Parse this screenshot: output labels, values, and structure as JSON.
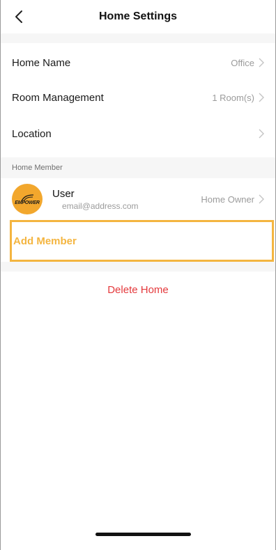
{
  "header": {
    "title": "Home Settings",
    "back_icon": "chevron-left-icon"
  },
  "settings": [
    {
      "label": "Home Name",
      "value": "Office"
    },
    {
      "label": "Room Management",
      "value": "1 Room(s)"
    },
    {
      "label": "Location",
      "value": ""
    }
  ],
  "members_section": {
    "heading": "Home Member",
    "members": [
      {
        "name": "User",
        "email": "email@address.com",
        "role": "Home Owner",
        "avatar_text": "EMPOWER"
      }
    ]
  },
  "add_member_label": "Add Member",
  "delete_home_label": "Delete Home",
  "colors": {
    "accent": "#f4b540",
    "danger": "#e4393c",
    "avatar": "#f2a72d"
  }
}
